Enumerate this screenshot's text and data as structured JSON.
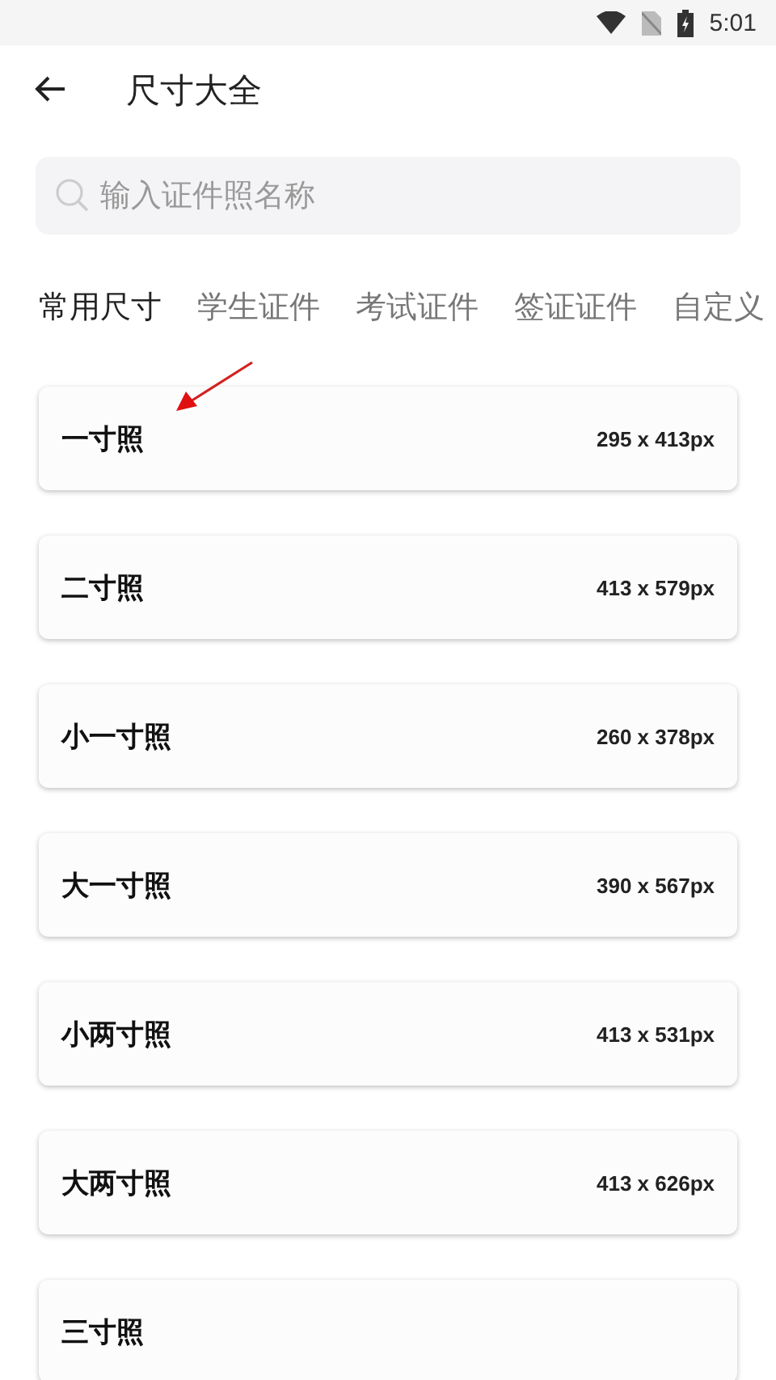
{
  "status_bar": {
    "time": "5:01"
  },
  "header": {
    "title": "尺寸大全"
  },
  "search": {
    "placeholder": "输入证件照名称"
  },
  "tabs": [
    {
      "label": "常用尺寸",
      "selected": true
    },
    {
      "label": "学生证件",
      "selected": false
    },
    {
      "label": "考试证件",
      "selected": false
    },
    {
      "label": "签证证件",
      "selected": false
    },
    {
      "label": "自定义",
      "selected": false
    }
  ],
  "sizes": [
    {
      "name": "一寸照",
      "pixels": "295 x 413px"
    },
    {
      "name": "二寸照",
      "pixels": "413 x 579px"
    },
    {
      "name": "小一寸照",
      "pixels": "260 x 378px"
    },
    {
      "name": "大一寸照",
      "pixels": "390 x 567px"
    },
    {
      "name": "小两寸照",
      "pixels": "413 x 531px"
    },
    {
      "name": "大两寸照",
      "pixels": "413 x 626px"
    },
    {
      "name": "三寸照"
    }
  ]
}
